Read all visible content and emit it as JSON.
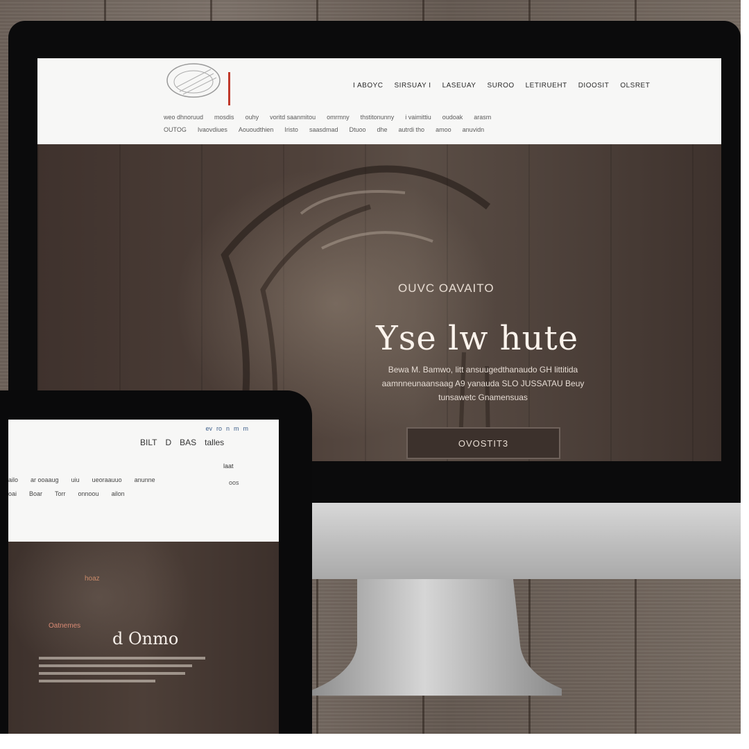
{
  "desktop": {
    "nav_primary": [
      "I ABOYC",
      "SIRSUAY I",
      "LASEUAY",
      "SUROO",
      "LETIRUEHT",
      "DIOOSIT",
      "OLSRET"
    ],
    "nav_row_1": [
      "weo dhnoruud",
      "mosdis",
      "ouhy",
      "voritd saanmitou",
      "omrmny",
      "thstitonunny",
      "i vaimittiu",
      "oudoak",
      "arasm"
    ],
    "nav_row_2": [
      "OUTOG",
      "Ivaovdiues",
      "Aououdthien",
      "Iristo",
      "saasdmad",
      "Dtuoo",
      "dhe",
      "autrdi tho",
      "amoo",
      "anuvidn"
    ],
    "hero": {
      "eyebrow": "OUVC OAVAITO",
      "title": "Yse lw hute",
      "body": "Bewa M. Bamwo, litt ansuugedthanaudo GH littitida aamnneunaansaag A9 yanauda SLO JUSSATAU Beuy tunsawetc Gnamensuas",
      "cta": "OVOSTIT3"
    }
  },
  "tablet": {
    "icons": [
      "ev",
      "ro",
      "n",
      "m",
      "m"
    ],
    "nav": [
      "BILT",
      "D",
      "BAS",
      "talles"
    ],
    "small_1": "laat",
    "small_2": "oos",
    "row_1": [
      "ailo",
      "ar ooaaug",
      "uiu",
      "ueoraauuo",
      "anunne"
    ],
    "row_2": [
      "oai",
      "Boar",
      "Torr",
      "onnoou",
      "ailon"
    ],
    "hero": {
      "eyebrow": "hoaz",
      "kicker": "Oatnemes",
      "title": "d Onmo"
    }
  },
  "colors": {
    "hero_bg": "#4a3d37",
    "topbar_bg": "#f7f7f6",
    "logo_red": "#c0392b",
    "nav_text": "#2a2a2a",
    "cta_bg": "#3c312c"
  }
}
